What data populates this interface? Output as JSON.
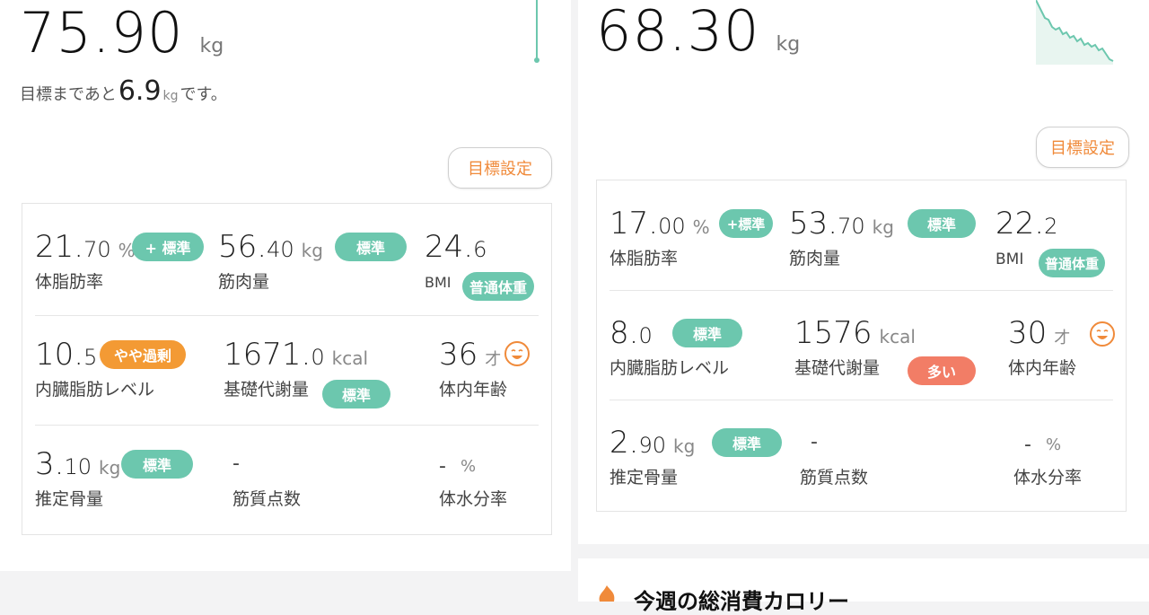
{
  "left": {
    "weight_value": "75.90",
    "weight_unit": "kg",
    "remain_prefix": "目標まであと",
    "remain_value": "6.9",
    "remain_unit": "kg",
    "remain_suffix": "です。",
    "goal_button": "目標設定",
    "metrics": {
      "body_fat": {
        "int": "21.",
        "dec": "70",
        "unit": "%",
        "label": "体脂肪率",
        "badge": "+ 標準"
      },
      "muscle": {
        "int": "56.",
        "dec": "40",
        "unit": "kg",
        "label": "筋肉量",
        "badge": "標準"
      },
      "bmi": {
        "int": "24.",
        "dec": "6",
        "unit": "",
        "label": "BMI",
        "badge": "普通体重"
      },
      "visceral": {
        "int": "10.",
        "dec": "5",
        "unit": "",
        "label": "内臓脂肪レベル",
        "badge": "やや過剰"
      },
      "bmr": {
        "int": "1671.",
        "dec": "0",
        "unit": "kcal",
        "label": "基礎代謝量",
        "badge": "標準"
      },
      "age": {
        "int": "36",
        "dec": "",
        "unit": "才",
        "label": "体内年齢"
      },
      "bone": {
        "int": "3.",
        "dec": "10",
        "unit": "kg",
        "label": "推定骨量",
        "badge": "標準"
      },
      "muscle_score": {
        "dash": "-",
        "label": "筋質点数"
      },
      "water": {
        "dash": "-",
        "unit": "%",
        "label": "体水分率"
      }
    }
  },
  "right": {
    "weight_value": "68.30",
    "weight_unit": "kg",
    "goal_button": "目標設定",
    "metrics": {
      "body_fat": {
        "int": "17.",
        "dec": "00",
        "unit": "%",
        "label": "体脂肪率",
        "badge": "+標準"
      },
      "muscle": {
        "int": "53.",
        "dec": "70",
        "unit": "kg",
        "label": "筋肉量",
        "badge": "標準"
      },
      "bmi": {
        "int": "22.",
        "dec": "2",
        "unit": "",
        "label": "BMI",
        "badge": "普通体重"
      },
      "visceral": {
        "int": "8.",
        "dec": "0",
        "unit": "",
        "label": "内臓脂肪レベル",
        "badge": "標準"
      },
      "bmr": {
        "int": "1576",
        "dec": "",
        "unit": "kcal",
        "label": "基礎代謝量",
        "badge": "多い"
      },
      "age": {
        "int": "30",
        "dec": "",
        "unit": "才",
        "label": "体内年齢"
      },
      "bone": {
        "int": "2.",
        "dec": "90",
        "unit": "kg",
        "label": "推定骨量",
        "badge": "標準"
      },
      "muscle_score": {
        "dash": "-",
        "label": "筋質点数"
      },
      "water": {
        "dash": "-",
        "unit": "%",
        "label": "体水分率"
      }
    },
    "section_title": "今週の総消費カロリー"
  },
  "colors": {
    "standard": "#6cc7ae",
    "slightly_high": "#f39a34",
    "high": "#f27d66",
    "accent": "#f08a3a"
  }
}
